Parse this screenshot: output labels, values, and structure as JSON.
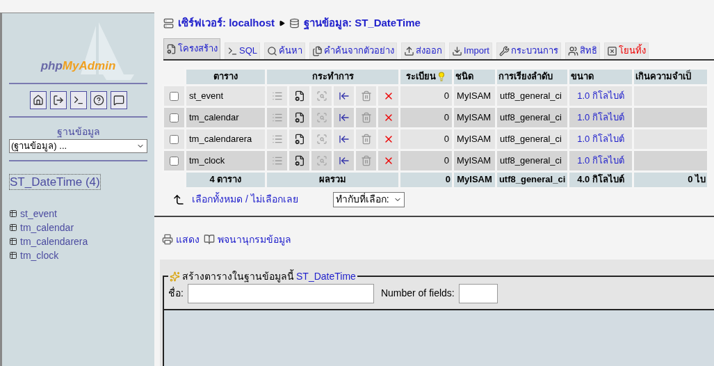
{
  "sidebar": {
    "logo_prefix": "php",
    "logo_suffix": "MyAdmin",
    "database_label": "ฐานข้อมูล",
    "database_select": "(ฐานข้อมูล) ...",
    "current_database": "ST_DateTime (4)",
    "tables": [
      "st_event",
      "tm_calendar",
      "tm_calendarera",
      "tm_clock"
    ]
  },
  "breadcrumb": {
    "server": "เซิร์ฟเวอร์: localhost",
    "database": "ฐานข้อมูล: ST_DateTime"
  },
  "tabs": [
    {
      "label": "โครงสร้าง",
      "kind": "structure",
      "selected": true,
      "danger": false
    },
    {
      "label": "SQL",
      "kind": "sql",
      "selected": false,
      "danger": false
    },
    {
      "label": "ค้นหา",
      "kind": "search",
      "selected": false,
      "danger": false
    },
    {
      "label": "คำค้นจากตัวอย่าง",
      "kind": "query",
      "selected": false,
      "danger": false
    },
    {
      "label": "ส่งออก",
      "kind": "export",
      "selected": false,
      "danger": false
    },
    {
      "label": "Import",
      "kind": "import",
      "selected": false,
      "danger": false
    },
    {
      "label": "กระบวนการ",
      "kind": "operations",
      "selected": false,
      "danger": false
    },
    {
      "label": "สิทธิ",
      "kind": "privileges",
      "selected": false,
      "danger": false
    },
    {
      "label": "โยนทิ้ง",
      "kind": "drop",
      "selected": false,
      "danger": true
    }
  ],
  "table": {
    "columns": [
      "ตาราง",
      "กระทำการ",
      "ระเบียน",
      "ชนิด",
      "การเรียงลำดับ",
      "ขนาด",
      "เกินความจำเป็"
    ],
    "rows": [
      {
        "name": "st_event",
        "checked": false,
        "records": "0",
        "type": "MyISAM",
        "collation": "utf8_general_ci",
        "size": "1.0 กิโลไบต์"
      },
      {
        "name": "tm_calendar",
        "checked": false,
        "records": "0",
        "type": "MyISAM",
        "collation": "utf8_general_ci",
        "size": "1.0 กิโลไบต์"
      },
      {
        "name": "tm_calendarera",
        "checked": false,
        "records": "0",
        "type": "MyISAM",
        "collation": "utf8_general_ci",
        "size": "1.0 กิโลไบต์"
      },
      {
        "name": "tm_clock",
        "checked": false,
        "records": "0",
        "type": "MyISAM",
        "collation": "utf8_general_ci",
        "size": "1.0 กิโลไบต์"
      }
    ],
    "footer": {
      "tables": "4 ตาราง",
      "label": "ผลรวม",
      "records": "0",
      "type": "MyISAM",
      "collation": "utf8_general_ci",
      "size": "4.0 กิโลไบต์",
      "overhead": "0 ไบ"
    }
  },
  "selection": {
    "check_all": "เลือกทั้งหมด",
    "separator": "/",
    "uncheck_all": "ไม่เลือกเลย",
    "with_selected": "ทำกับที่เลือก:"
  },
  "links": [
    {
      "label": "แสดง",
      "kind": "print"
    },
    {
      "label": "พจนานุกรมข้อมูล",
      "kind": "dictionary"
    }
  ],
  "create_table": {
    "legend": "สร้างตารางในฐานข้อมูลนี้",
    "database": "ST_DateTime",
    "name_label": "ชื่อ:",
    "fields_label": "Number of fields:"
  }
}
